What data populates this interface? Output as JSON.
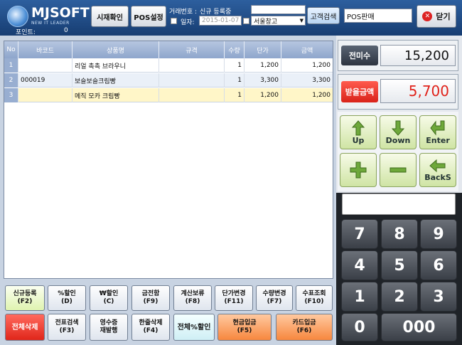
{
  "header": {
    "logo_text": "MJSOFT",
    "logo_sub": "NEW IT LEADER",
    "points_label": "포인트:",
    "points_value": "0",
    "check_time_label": "시재확인",
    "pos_settings_label": "POS설정",
    "trade_no_label": "거래번호 :",
    "trade_status": "신규 등록중",
    "date_label": "일자:",
    "date_value": "2015-01-07",
    "warehouse_value": "서울창고",
    "customer_search_label": "고객검색",
    "pos_mode": "POS판매",
    "close_label": "닫기"
  },
  "table": {
    "columns": [
      "No",
      "바코드",
      "상품명",
      "규격",
      "수량",
      "단가",
      "금액"
    ],
    "rows": [
      {
        "no": "1",
        "barcode": "",
        "name": "리얼 촉촉 브라우니",
        "spec": "",
        "qty": "1",
        "price": "1,200",
        "amount": "1,200"
      },
      {
        "no": "2",
        "barcode": "000019",
        "name": "보슬보슬크림빵",
        "spec": "",
        "qty": "1",
        "price": "3,300",
        "amount": "3,300"
      },
      {
        "no": "3",
        "barcode": "",
        "name": "메직 모카 크림빵",
        "spec": "",
        "qty": "1",
        "price": "1,200",
        "amount": "1,200"
      }
    ]
  },
  "functions": {
    "row1": [
      {
        "line1": "신규등록",
        "line2": "(F2)"
      },
      {
        "line1": "%할인",
        "line2": "(D)"
      },
      {
        "line1": "₩할인",
        "line2": "(C)"
      },
      {
        "line1": "금전함",
        "line2": "(F9)"
      },
      {
        "line1": "계산보류",
        "line2": "(F8)"
      },
      {
        "line1": "단가변경",
        "line2": "(F11)"
      },
      {
        "line1": "수량변경",
        "line2": "(F7)"
      },
      {
        "line1": "수표조회",
        "line2": "(F10)"
      }
    ],
    "row2": [
      {
        "line1": "전체삭제",
        "line2": ""
      },
      {
        "line1": "전표검색",
        "line2": "(F3)"
      },
      {
        "line1": "영수증",
        "line2": "재발행"
      },
      {
        "line1": "한줄삭제",
        "line2": "(F4)"
      },
      {
        "line1": "전체%할인",
        "line2": ""
      },
      {
        "line1": "현금입금",
        "line2": "(F5)"
      },
      {
        "line1": "카드입금",
        "line2": "(F6)"
      }
    ]
  },
  "summary": {
    "prev_balance_label": "전미수",
    "prev_balance_value": "15,200",
    "receive_label": "받을금액",
    "receive_value": "5,700"
  },
  "nav": {
    "up": "Up",
    "down": "Down",
    "enter": "Enter",
    "backspace": "BackS"
  },
  "keypad": {
    "display_value": "",
    "keys": [
      "7",
      "8",
      "9",
      "4",
      "5",
      "6",
      "1",
      "2",
      "3",
      "0",
      "000"
    ]
  },
  "colors": {
    "header_bg": "#1f4a86",
    "receive_value_color": "#e0221a",
    "highlight_row": "#fff6c8"
  }
}
